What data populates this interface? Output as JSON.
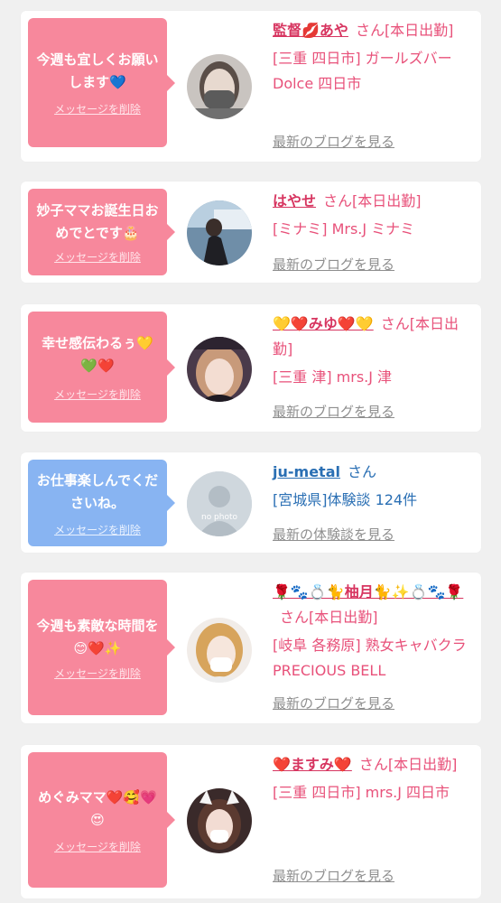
{
  "cards": [
    {
      "message": "今週も宜しくお願いします💙",
      "delete_label": "メッセージを削除",
      "name": "監督💋あや",
      "honorific": "さん[本日出勤]",
      "shop": "[三重 四日市] ガールズバー Dolce 四日市",
      "link": "最新のブログを見る"
    },
    {
      "message": "妙子ママお誕生日おめでとです🎂",
      "delete_label": "メッセージを削除",
      "name": "はやせ",
      "honorific": "さん[本日出勤]",
      "shop": "[ミナミ] Mrs.J ミナミ",
      "link": "最新のブログを見る"
    },
    {
      "message": "幸せ感伝わるぅ💛💚❤️",
      "delete_label": "メッセージを削除",
      "name": "💛❤️みゆ❤️💛",
      "honorific": "さん[本日出勤]",
      "shop": "[三重 津] mrs.J 津",
      "link": "最新のブログを見る"
    },
    {
      "message": "お仕事楽しんでくださいね。",
      "delete_label": "メッセージを削除",
      "name": "ju-metal",
      "honorific": "さん",
      "shop": "[宮城県]体験談 124件",
      "link": "最新の体験談を見る",
      "avatar_text": "no photo"
    },
    {
      "message": "今週も素敵な時間を😊❤️✨",
      "delete_label": "メッセージを削除",
      "name": "🌹🐾💍🐈柚月🐈✨💍🐾🌹",
      "honorific": "さん[本日出勤]",
      "shop": "[岐阜 各務原] 熟女キャバクラ PRECIOUS BELL",
      "link": "最新のブログを見る"
    },
    {
      "message": "めぐみママ❤️🥰💗😍",
      "delete_label": "メッセージを削除",
      "name": "❤️ますみ❤️",
      "honorific": "さん[本日出勤]",
      "shop": "[三重 四日市] mrs.J 四日市",
      "link": "最新のブログを見る"
    }
  ],
  "colors": {
    "pink_bubble": "#f7889c",
    "blue_bubble": "#88b4f2",
    "pink_text": "#e8517a",
    "blue_text": "#2a6fb4",
    "link_gray": "#8e8e8e"
  }
}
